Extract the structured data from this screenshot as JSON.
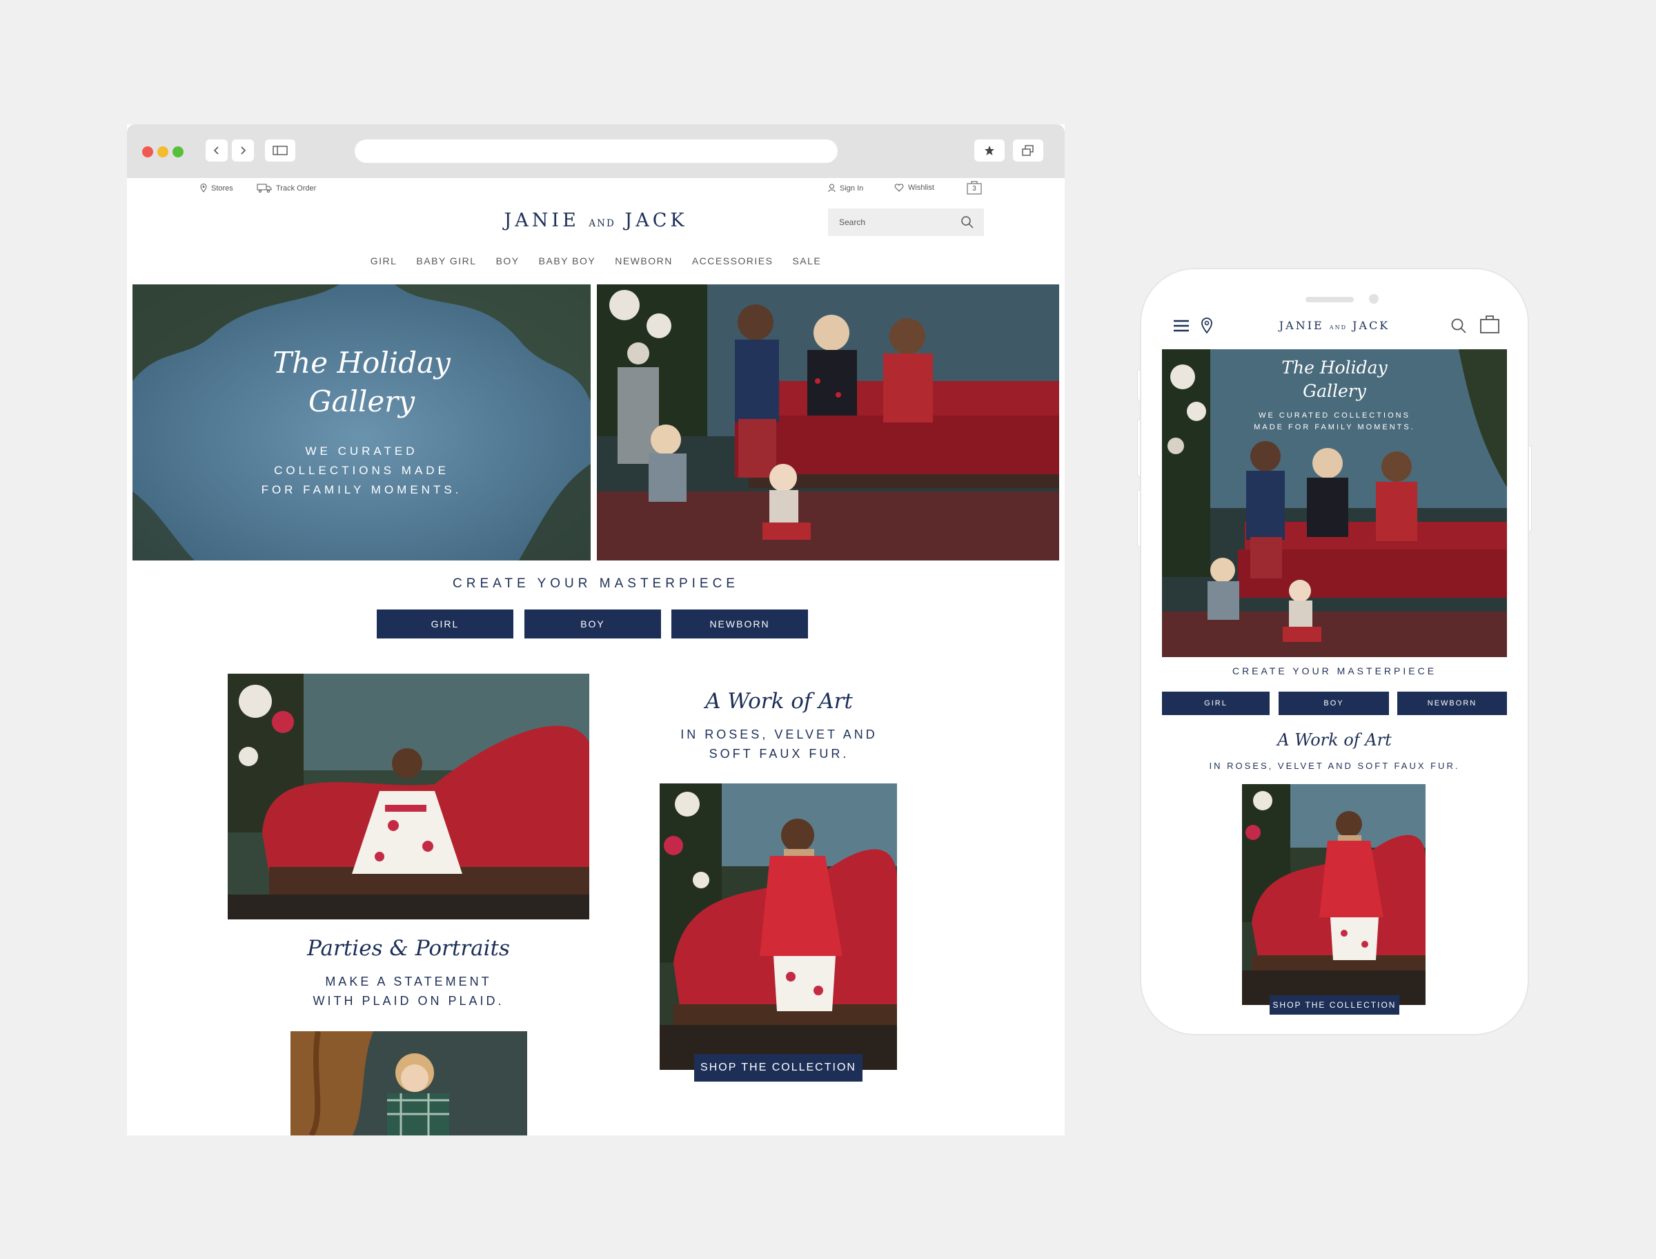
{
  "browser": {
    "topbar": {
      "stores": "Stores",
      "track_order": "Track Order",
      "sign_in": "Sign In",
      "wishlist": "Wishlist",
      "cart_count": "3"
    },
    "logo": {
      "left": "JANIE",
      "middle": "AND",
      "right": "JACK"
    },
    "search_placeholder": "Search",
    "nav": [
      "GIRL",
      "BABY GIRL",
      "BOY",
      "BABY BOY",
      "NEWBORN",
      "ACCESSORIES",
      "SALE"
    ],
    "hero": {
      "title_line1": "The Holiday",
      "title_line2": "Gallery",
      "sub_line1": "WE CURATED",
      "sub_line2": "COLLECTIONS MADE",
      "sub_line3": "FOR FAMILY MOMENTS."
    },
    "masterpiece": "CREATE YOUR MASTERPIECE",
    "buttons": [
      "GIRL",
      "BOY",
      "NEWBORN"
    ],
    "work_of_art": {
      "title": "A Work of Art",
      "line1": "IN ROSES, VELVET AND",
      "line2": "SOFT FAUX FUR."
    },
    "parties": {
      "title": "Parties & Portraits",
      "line1": "MAKE A STATEMENT",
      "line2": "WITH PLAID ON PLAID."
    },
    "shop_the_collection": "SHOP THE COLLECTION"
  },
  "phone": {
    "logo": {
      "left": "JANIE",
      "middle": "AND",
      "right": "JACK"
    },
    "hero": {
      "title_line1": "The Holiday",
      "title_line2": "Gallery",
      "sub_line1": "WE CURATED COLLECTIONS",
      "sub_line2": "MADE FOR FAMILY MOMENTS."
    },
    "masterpiece": "CREATE YOUR MASTERPIECE",
    "buttons": [
      "GIRL",
      "BOY",
      "NEWBORN"
    ],
    "work_of_art": {
      "title": "A Work of Art",
      "line1": "IN ROSES, VELVET AND SOFT FAUX FUR."
    },
    "shop_the_collection": "SHOP THE COLLECTION"
  },
  "colors": {
    "navy": "#1d2f57",
    "red": "#c0283a",
    "sky": "#5b7f9a",
    "foliage": "#2c3a2a"
  }
}
